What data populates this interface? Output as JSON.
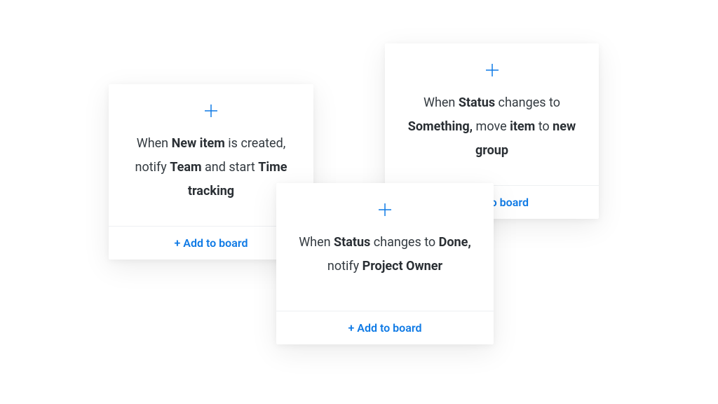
{
  "colors": {
    "accent": "#0f7ae5",
    "text": "#333a40"
  },
  "cards": [
    {
      "segments": [
        {
          "t": "When ",
          "b": false
        },
        {
          "t": "New item",
          "b": true
        },
        {
          "t": " is created, notify ",
          "b": false
        },
        {
          "t": "Team",
          "b": true
        },
        {
          "t": " and start ",
          "b": false
        },
        {
          "t": "Time tracking",
          "b": true
        }
      ],
      "cta": "+ Add to board"
    },
    {
      "segments": [
        {
          "t": "When ",
          "b": false
        },
        {
          "t": "Status",
          "b": true
        },
        {
          "t": " changes to ",
          "b": false
        },
        {
          "t": "Something,",
          "b": true
        },
        {
          "t": " move ",
          "b": false
        },
        {
          "t": "item",
          "b": true
        },
        {
          "t": " to ",
          "b": false
        },
        {
          "t": "new group",
          "b": true
        }
      ],
      "cta": "+ Add to board"
    },
    {
      "segments": [
        {
          "t": "When ",
          "b": false
        },
        {
          "t": "Status",
          "b": true
        },
        {
          "t": " changes to ",
          "b": false
        },
        {
          "t": "Done,",
          "b": true
        },
        {
          "t": " notify ",
          "b": false
        },
        {
          "t": "Project Owner",
          "b": true
        }
      ],
      "cta": "+ Add to board"
    }
  ]
}
